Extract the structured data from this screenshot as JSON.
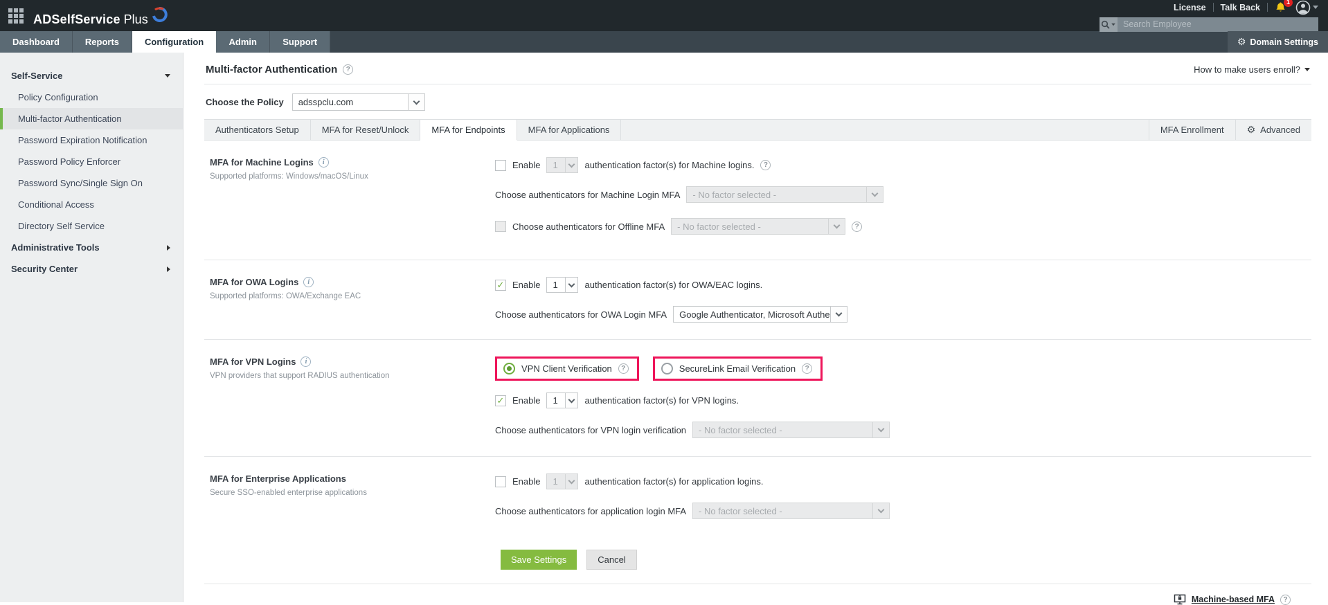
{
  "brand": {
    "name_bold": "ADSelfService",
    "name_tail": "Plus"
  },
  "header": {
    "license": "License",
    "talkback": "Talk Back",
    "notif_count": "1",
    "search_placeholder": "Search Employee",
    "domain_settings": "Domain Settings"
  },
  "nav": {
    "tabs": [
      "Dashboard",
      "Reports",
      "Configuration",
      "Admin",
      "Support"
    ]
  },
  "sidebar": {
    "self_service": "Self-Service",
    "items": [
      "Policy Configuration",
      "Multi-factor Authentication",
      "Password Expiration Notification",
      "Password Policy Enforcer",
      "Password Sync/Single Sign On",
      "Conditional Access",
      "Directory Self Service"
    ],
    "admin_tools": "Administrative Tools",
    "security_center": "Security Center"
  },
  "page": {
    "title": "Multi-factor Authentication",
    "enroll_link": "How to make users enroll?",
    "policy_label": "Choose the Policy",
    "policy_value": "adsspclu.com",
    "tabs": [
      "Authenticators Setup",
      "MFA for Reset/Unlock",
      "MFA for Endpoints",
      "MFA for Applications"
    ],
    "active_tab": "MFA for Endpoints",
    "tab_enrollment": "MFA Enrollment",
    "tab_advanced": "Advanced",
    "save": "Save Settings",
    "cancel": "Cancel",
    "footer_link": "Machine-based MFA"
  },
  "icons": {
    "info": "i",
    "help": "?",
    "gear": "⚙"
  },
  "sections": {
    "machine": {
      "title": "MFA for Machine Logins",
      "subtitle": "Supported platforms: Windows/macOS/Linux",
      "enable_label": "Enable",
      "factor_value": "1",
      "enable_text": "authentication factor(s) for Machine logins.",
      "choose_label": "Choose authenticators for Machine Login MFA",
      "choose_value": "- No factor selected -",
      "offline_label": "Choose authenticators for Offline MFA",
      "offline_value": "- No factor selected -",
      "enable_checked": false
    },
    "owa": {
      "title": "MFA for OWA Logins",
      "subtitle": "Supported platforms: OWA/Exchange EAC",
      "enable_label": "Enable",
      "factor_value": "1",
      "enable_text": "authentication factor(s) for OWA/EAC logins.",
      "choose_label": "Choose authenticators for OWA Login MFA",
      "choose_value": "Google Authenticator, Microsoft Authe",
      "enable_checked": true
    },
    "vpn": {
      "title": "MFA for VPN Logins",
      "subtitle": "VPN providers that support RADIUS authentication",
      "radio_client": "VPN Client Verification",
      "radio_securelink": "SecureLink Email Verification",
      "radio_selected": "VPN Client Verification",
      "enable_label": "Enable",
      "factor_value": "1",
      "enable_text": "authentication factor(s) for VPN logins.",
      "choose_label": "Choose authenticators for VPN login verification",
      "choose_value": "- No factor selected -",
      "enable_checked": true
    },
    "enterprise": {
      "title": "MFA for Enterprise Applications",
      "subtitle": "Secure SSO-enabled enterprise applications",
      "enable_label": "Enable",
      "factor_value": "1",
      "enable_text": "authentication factor(s) for application logins.",
      "choose_label": "Choose authenticators for application login MFA",
      "choose_value": "- No factor selected -",
      "enable_checked": false
    }
  },
  "colors": {
    "highlight_pink": "#ee155a",
    "accent_green": "#76b84e",
    "save_green": "#85bb40",
    "badge_red": "#e02020",
    "header_dark": "#21282c",
    "nav_slate": "#5b6a74"
  }
}
